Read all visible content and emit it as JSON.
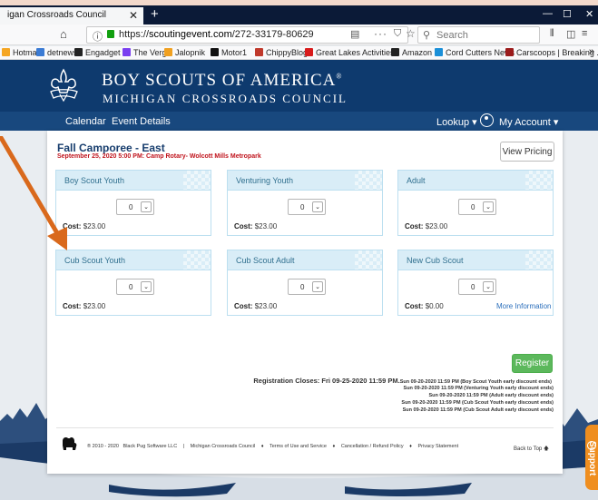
{
  "browser": {
    "tab_title": "igan Crossroads Council",
    "tab_close": "✕",
    "new_tab": "+",
    "url_scheme": "https://",
    "url_domain": "scoutingevent.com",
    "url_path": "/272-33179-80629",
    "search_placeholder": "Search",
    "window_controls": [
      "—",
      "☐",
      "✕"
    ]
  },
  "bookmarks": [
    {
      "label": "Hotmail",
      "color": "#f5a623"
    },
    {
      "label": "detnews",
      "color": "#3b7bd4"
    },
    {
      "label": "Engadget",
      "color": "#222222"
    },
    {
      "label": "The Verge",
      "color": "#7a3ff0"
    },
    {
      "label": "Jalopnik",
      "color": "#f0a020"
    },
    {
      "label": "Motor1",
      "color": "#111111"
    },
    {
      "label": "ChippyBlog",
      "color": "#c0392b"
    },
    {
      "label": "Great Lakes Activities",
      "color": "#d81b1b"
    },
    {
      "label": "Amazon",
      "color": "#222222"
    },
    {
      "label": "Cord Cutters News",
      "color": "#1a8fd8"
    },
    {
      "label": "Carscoops | Breaking ...",
      "color": "#9b1b1b"
    }
  ],
  "bookmarks_more": "»",
  "site": {
    "org_line1": "BOY SCOUTS OF AMERICA",
    "org_mark": "®",
    "org_line2": "MICHIGAN CROSSROADS COUNCIL",
    "nav_calendar": "Calendar",
    "nav_event_details": "Event Details",
    "nav_lookup": "Lookup ▾",
    "nav_account": "My Account ▾"
  },
  "event": {
    "title": "Fall Camporee - East",
    "subtitle": "September 25, 2020 5:00 PM: Camp Rotary- Wolcott Mills Metropark",
    "view_pricing": "View Pricing"
  },
  "panels": [
    {
      "title": "Boy Scout Youth",
      "qty": "0",
      "cost_label": "Cost:",
      "cost": "$23.00",
      "more": ""
    },
    {
      "title": "Venturing Youth",
      "qty": "0",
      "cost_label": "Cost:",
      "cost": "$23.00",
      "more": ""
    },
    {
      "title": "Adult",
      "qty": "0",
      "cost_label": "Cost:",
      "cost": "$23.00",
      "more": ""
    },
    {
      "title": "Cub Scout Youth",
      "qty": "0",
      "cost_label": "Cost:",
      "cost": "$23.00",
      "more": ""
    },
    {
      "title": "Cub Scout Adult",
      "qty": "0",
      "cost_label": "Cost:",
      "cost": "$23.00",
      "more": ""
    },
    {
      "title": "New Cub Scout",
      "qty": "0",
      "cost_label": "Cost:",
      "cost": "$0.00",
      "more": "More Information"
    }
  ],
  "registration": {
    "register_label": "Register",
    "closes_label": "Registration Closes:",
    "closes_value": "Fri 09-25-2020 11:59 PM.",
    "first_discount": "Sun 09-20-2020 11:59 PM (Boy Scout Youth early discount ends)",
    "discounts": [
      "Sun 09-20-2020 11:59 PM (Venturing Youth early discount ends)",
      "Sun 09-20-2020 11:59 PM (Adult early discount ends)",
      "Sun 09-20-2020 11:59 PM (Cub Scout Youth early discount ends)",
      "Sun 09-20-2020 11:59 PM (Cub Scout Adult early discount ends)"
    ]
  },
  "footer": {
    "copyright": "® 2010 - 2020",
    "links": [
      "Black Pug Software LLC",
      "Michigan Crossroads Council",
      "Terms of Use and Service",
      "Cancellation / Refund Policy",
      "Privacy Statement"
    ],
    "back_to_top": "Back to Top",
    "support": "Support"
  },
  "colors": {
    "header_blue": "#0e3a6e",
    "nav_blue": "#18487e",
    "panel_head": "#d9edf7",
    "register_green": "#5cb85c",
    "arrow_orange": "#d9691c",
    "support_orange": "#ef8e1f"
  }
}
